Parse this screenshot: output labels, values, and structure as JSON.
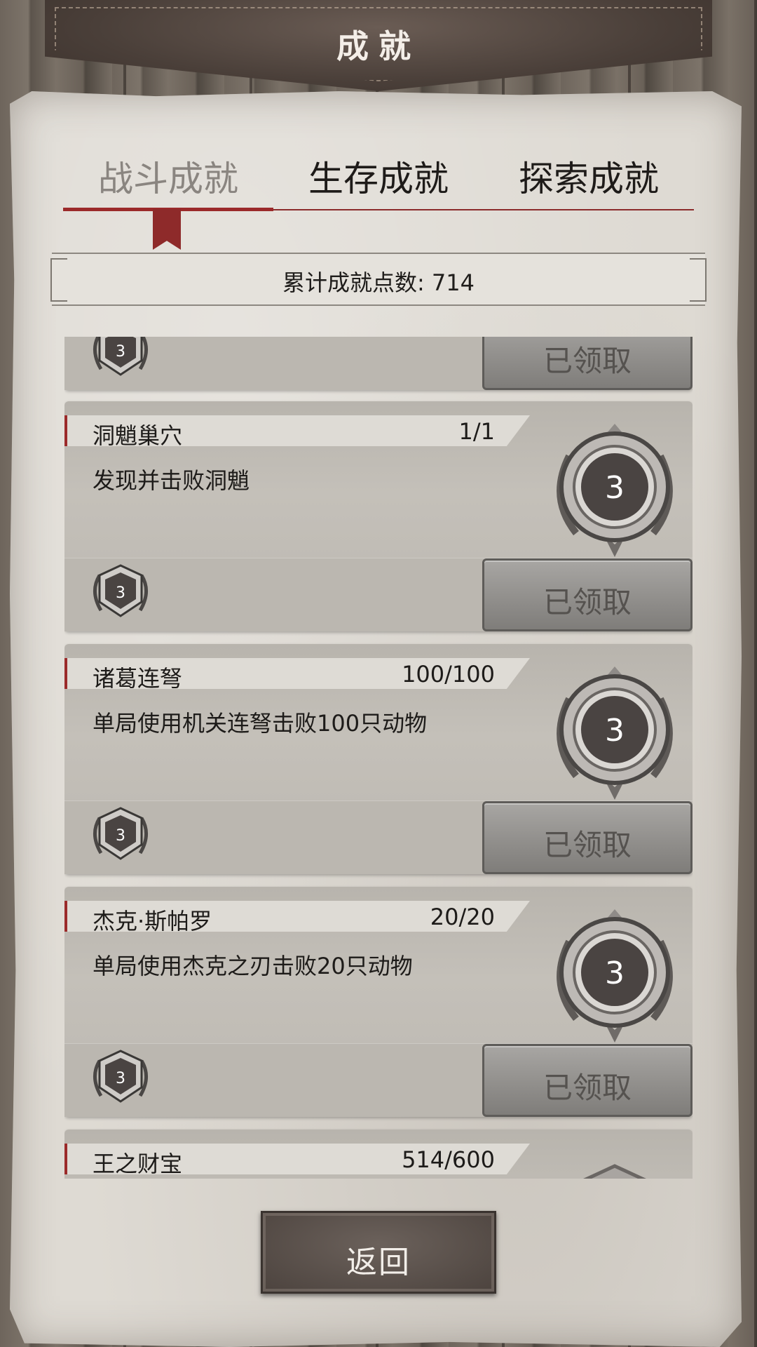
{
  "header": {
    "title": "成就"
  },
  "tabs": [
    {
      "label": "战斗成就",
      "active": true
    },
    {
      "label": "生存成就",
      "active": false
    },
    {
      "label": "探索成就",
      "active": false
    }
  ],
  "points": {
    "text": "累计成就点数: 714"
  },
  "achievements": [
    {
      "name": "",
      "progress": "",
      "desc": "",
      "badge_points": "3",
      "button": "已领取"
    },
    {
      "name": "洞魈巢穴",
      "progress": "1/1",
      "desc": "发现并击败洞魈",
      "badge_points": "3",
      "button": "已领取"
    },
    {
      "name": "诸葛连弩",
      "progress": "100/100",
      "desc": "单局使用机关连弩击败100只动物",
      "badge_points": "3",
      "button": "已领取"
    },
    {
      "name": "杰克·斯帕罗",
      "progress": "20/20",
      "desc": "单局使用杰克之刃击败20只动物",
      "badge_points": "3",
      "button": "已领取"
    },
    {
      "name": "王之财宝",
      "progress": "514/600",
      "desc": "",
      "badge_points": "",
      "button": ""
    }
  ],
  "footer": {
    "back_label": "返回"
  },
  "colors": {
    "accent": "#9b2a2a",
    "paper": "#dedad3",
    "card": "#c0bcb5",
    "leather": "#4a3f39"
  }
}
